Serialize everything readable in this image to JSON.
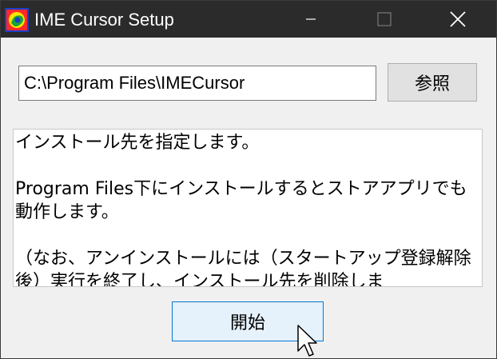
{
  "window": {
    "title": "IME Cursor Setup",
    "controls": [
      "minimize-icon",
      "maximize-icon",
      "close-icon"
    ]
  },
  "install": {
    "path_value": "C:\\Program Files\\IMECursor",
    "browse_label": "参照"
  },
  "description": {
    "paragraphs": [
      "インストール先を指定します。",
      "Program Files下にインストールするとストアアプリでも動作します。",
      "（なお、アンインストールには（スタートアップ登録解除後）実行を終了し、インストール先を削除しま"
    ]
  },
  "start_label": "開始",
  "colors": {
    "titlebar": "#2b2b2b",
    "accent": "#0078d7",
    "start_bg": "#e5f1fb"
  }
}
